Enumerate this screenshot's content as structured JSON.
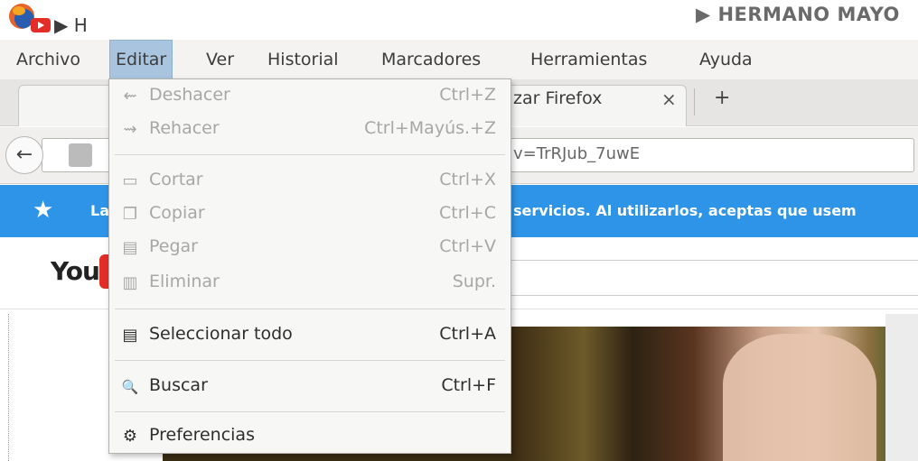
{
  "window": {
    "title": "▶ HERMANO MAYO"
  },
  "menubar": {
    "items": [
      "Archivo",
      "Editar",
      "Ver",
      "Historial",
      "Marcadores",
      "Herramientas",
      "Ayuda"
    ],
    "active": "Editar"
  },
  "tabs": {
    "tab1_prefix": "▶ H",
    "tab2_label": "zar Firefox",
    "close_glyph": "×",
    "new_tab_glyph": "+"
  },
  "nav": {
    "back_glyph": "←",
    "url_visible": "v=TrRJub_7uwE"
  },
  "notification": {
    "star": "★",
    "left_text": "Las",
    "right_text": "servicios. Al utilizarlos, aceptas que usem"
  },
  "youtube": {
    "logo_text": "You"
  },
  "edit_menu": {
    "items": [
      {
        "icon": "undo-icon",
        "glyph": "⇜",
        "label": "Deshacer",
        "shortcut": "Ctrl+Z",
        "enabled": false
      },
      {
        "icon": "redo-icon",
        "glyph": "⇝",
        "label": "Rehacer",
        "shortcut": "Ctrl+Mayús.+Z",
        "enabled": false
      },
      {
        "icon": "cut-icon",
        "glyph": "▭",
        "label": "Cortar",
        "shortcut": "Ctrl+X",
        "enabled": false
      },
      {
        "icon": "copy-icon",
        "glyph": "❐",
        "label": "Copiar",
        "shortcut": "Ctrl+C",
        "enabled": false
      },
      {
        "icon": "paste-icon",
        "glyph": "▤",
        "label": "Pegar",
        "shortcut": "Ctrl+V",
        "enabled": false
      },
      {
        "icon": "delete-icon",
        "glyph": "▥",
        "label": "Eliminar",
        "shortcut": "Supr.",
        "enabled": false
      },
      {
        "icon": "select-all-icon",
        "glyph": "▤",
        "label": "Seleccionar todo",
        "shortcut": "Ctrl+A",
        "enabled": true
      },
      {
        "icon": "search-icon",
        "glyph": "🔍",
        "label": "Buscar",
        "shortcut": "Ctrl+F",
        "enabled": true
      },
      {
        "icon": "gear-icon",
        "glyph": "⚙",
        "label": "Preferencias",
        "shortcut": "",
        "enabled": true
      }
    ]
  }
}
